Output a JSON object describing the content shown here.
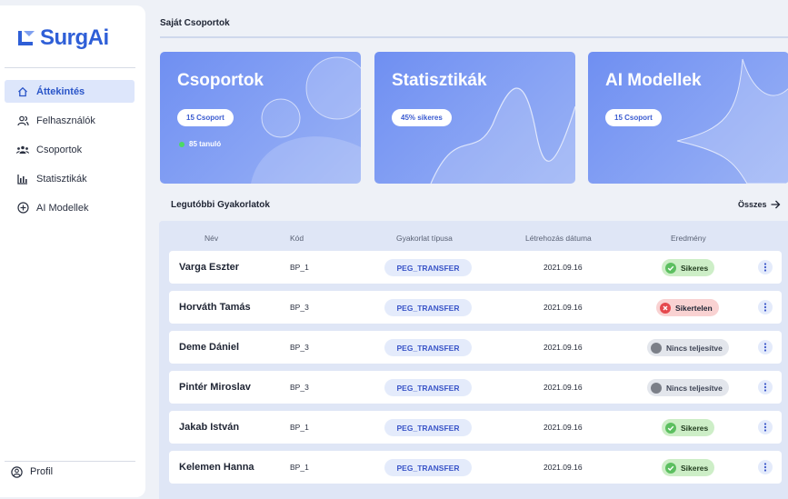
{
  "app": {
    "name": "SurgAi"
  },
  "sidebar": {
    "items": [
      {
        "label": "Áttekintés",
        "icon": "home-icon",
        "active": true
      },
      {
        "label": "Felhasználók",
        "icon": "users-icon"
      },
      {
        "label": "Csoportok",
        "icon": "groups-icon"
      },
      {
        "label": "Statisztikák",
        "icon": "bar-chart-icon"
      },
      {
        "label": "AI Modellek",
        "icon": "plus-circle-icon"
      }
    ],
    "profile": "Profil"
  },
  "header": {
    "title": "Saját Csoportok"
  },
  "cards": [
    {
      "title": "Csoportok",
      "pill": "15 Csoport",
      "extra": "85 tanuló"
    },
    {
      "title": "Statisztikák",
      "pill": "45% sikeres"
    },
    {
      "title": "AI Modellek",
      "pill": "15 Csoport"
    }
  ],
  "recent": {
    "title": "Legutóbbi Gyakorlatok",
    "all_label": "Összes",
    "columns": [
      "Név",
      "Kód",
      "Gyakorlat típusa",
      "Létrehozás dátuma",
      "Eredmény"
    ],
    "rows": [
      {
        "name": "Varga Eszter",
        "code": "BP_1",
        "type": "PEG_TRANSFER",
        "date": "2021.09.16",
        "result": "Sikeres",
        "status": "ok"
      },
      {
        "name": "Horváth Tamás",
        "code": "BP_3",
        "type": "PEG_TRANSFER",
        "date": "2021.09.16",
        "result": "Sikertelen",
        "status": "fail"
      },
      {
        "name": "Deme Dániel",
        "code": "BP_3",
        "type": "PEG_TRANSFER",
        "date": "2021.09.16",
        "result": "Nincs teljesítve",
        "status": "none"
      },
      {
        "name": "Pintér Miroslav",
        "code": "BP_3",
        "type": "PEG_TRANSFER",
        "date": "2021.09.16",
        "result": "Nincs teljesítve",
        "status": "none"
      },
      {
        "name": "Jakab István",
        "code": "BP_1",
        "type": "PEG_TRANSFER",
        "date": "2021.09.16",
        "result": "Sikeres",
        "status": "ok"
      },
      {
        "name": "Kelemen Hanna",
        "code": "BP_1",
        "type": "PEG_TRANSFER",
        "date": "2021.09.16",
        "result": "Sikeres",
        "status": "ok"
      }
    ]
  },
  "colors": {
    "accent": "#2f5fd7",
    "card_from": "#6f8ff2",
    "card_to": "#9ab2f5",
    "success": "#4caf50",
    "error": "#e5484d",
    "neutral": "#7b7f88"
  }
}
